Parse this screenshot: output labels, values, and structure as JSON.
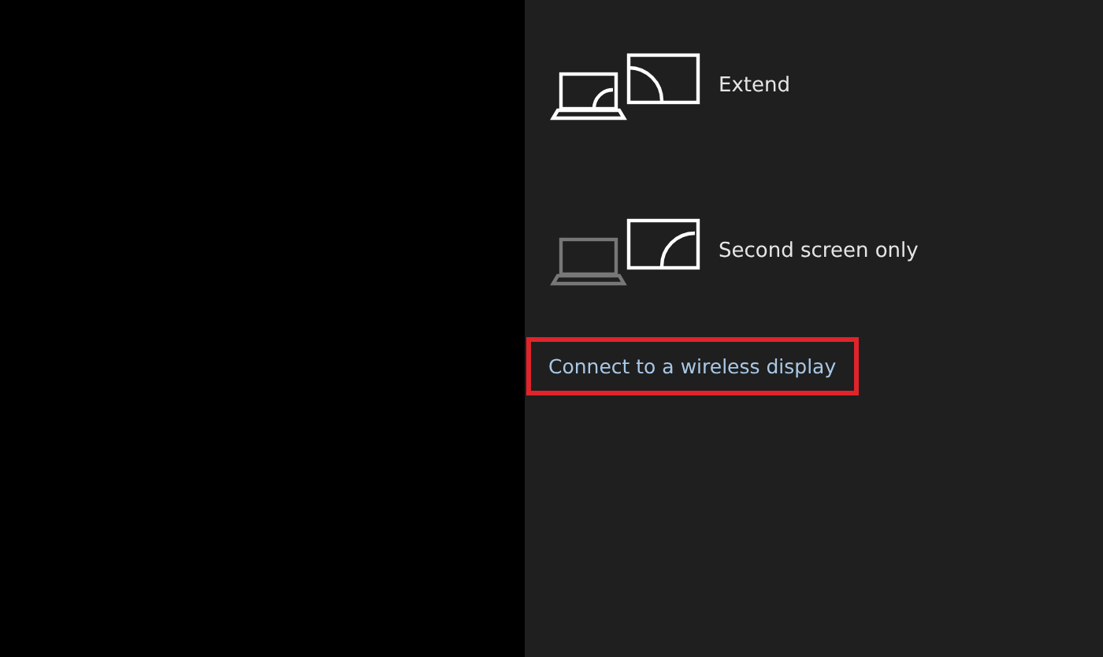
{
  "options": [
    {
      "kind": "extend",
      "label": "Extend"
    },
    {
      "kind": "second_screen_only",
      "label": "Second screen only"
    }
  ],
  "link": {
    "label": "Connect to a wireless display",
    "highlighted": true
  }
}
